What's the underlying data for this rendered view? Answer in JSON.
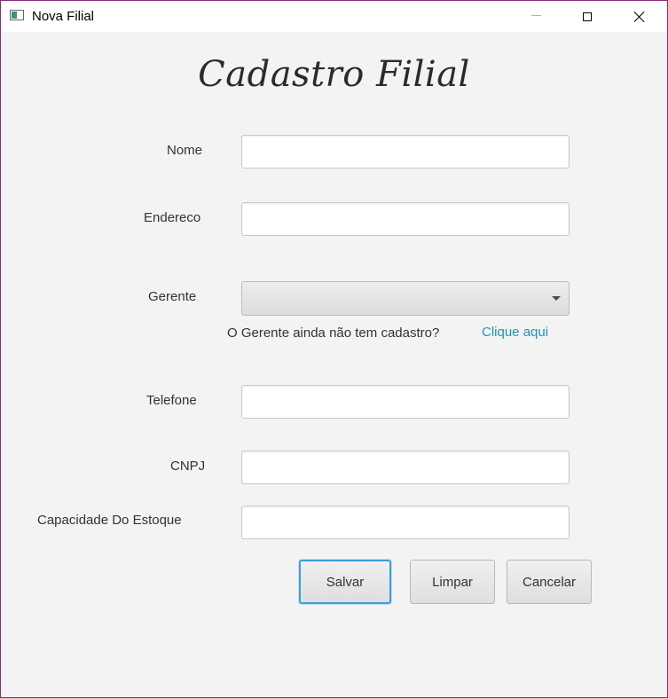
{
  "window": {
    "title": "Nova Filial"
  },
  "form": {
    "heading": "Cadastro Filial",
    "fields": {
      "nome": {
        "label": "Nome",
        "value": ""
      },
      "endereco": {
        "label": "Endereco",
        "value": ""
      },
      "gerente": {
        "label": "Gerente",
        "selected": ""
      },
      "telefone": {
        "label": "Telefone",
        "value": ""
      },
      "cnpj": {
        "label": "CNPJ",
        "value": ""
      },
      "capacidade": {
        "label": "Capacidade Do Estoque",
        "value": ""
      }
    },
    "gerente_hint": "O Gerente ainda não tem cadastro?",
    "gerente_link": "Clique aqui"
  },
  "buttons": {
    "save": "Salvar",
    "clear": "Limpar",
    "cancel": "Cancelar"
  },
  "icons": {
    "app": "java-app-icon",
    "minimize": "minimize-icon",
    "maximize": "maximize-icon",
    "close": "close-icon",
    "dropdown": "chevron-down-icon"
  },
  "colors": {
    "link": "#1f93c4",
    "focus": "#3aa0d8",
    "window_border": "#8a2b7a"
  }
}
